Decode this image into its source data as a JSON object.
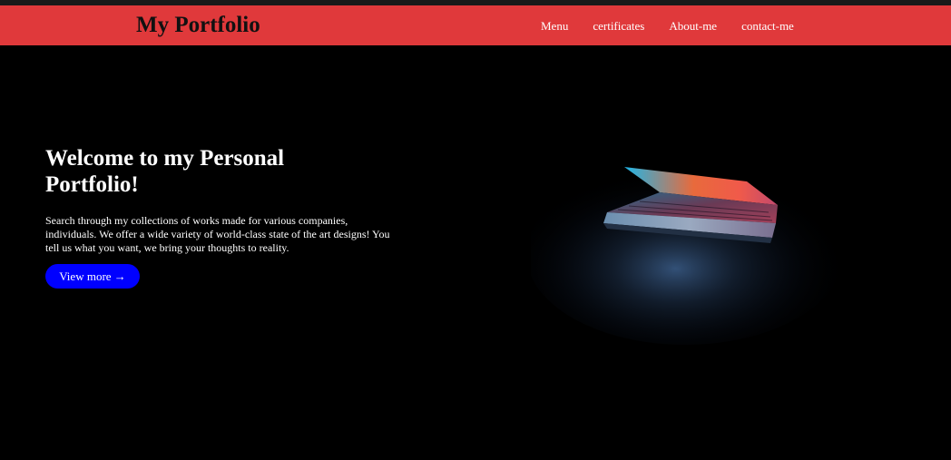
{
  "navbar": {
    "brand": "My Portfolio",
    "links": [
      "Menu",
      "certificates",
      "About-me",
      "contact-me"
    ],
    "background_color": "#e0393b"
  },
  "hero": {
    "title": "Welcome to my Personal Portfolio!",
    "description": "Search through my collections of works made for various companies, individuals. We offer a wide variety of world-class state of the art designs! You tell us what you want, we bring your thoughts to reality.",
    "button_label": "View more →",
    "button_color": "#0000ff",
    "image_icon": "laptop-image"
  }
}
